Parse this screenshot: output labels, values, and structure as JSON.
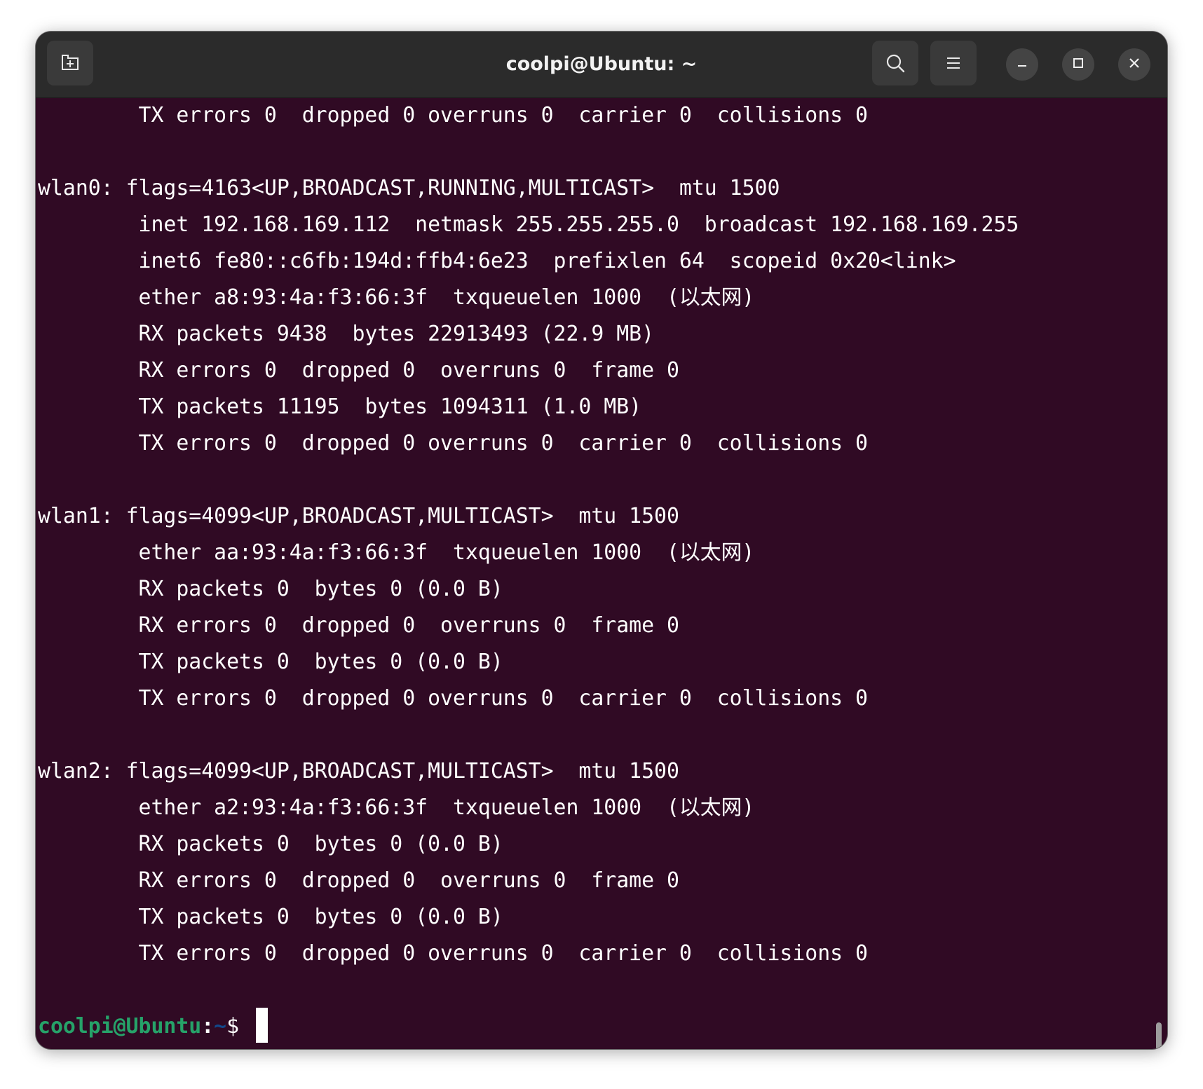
{
  "window": {
    "title": "coolpi@Ubuntu: ~"
  },
  "toolbar": {
    "new_tab_icon": "new-tab-icon",
    "search_icon": "search-icon",
    "menu_icon": "hamburger-menu-icon",
    "minimize_icon": "minimize-icon",
    "maximize_icon": "maximize-icon",
    "close_icon": "close-icon"
  },
  "colors": {
    "terminal_bg": "#300a24",
    "titlebar_bg": "#2b2b2b",
    "prompt_user": "#26a269",
    "prompt_path": "#12488b",
    "text": "#ffffff"
  },
  "terminal": {
    "lines": [
      "        TX errors 0  dropped 0 overruns 0  carrier 0  collisions 0",
      "",
      "wlan0: flags=4163<UP,BROADCAST,RUNNING,MULTICAST>  mtu 1500",
      "        inet 192.168.169.112  netmask 255.255.255.0  broadcast 192.168.169.255",
      "        inet6 fe80::c6fb:194d:ffb4:6e23  prefixlen 64  scopeid 0x20<link>",
      "        ether a8:93:4a:f3:66:3f  txqueuelen 1000  (以太网)",
      "        RX packets 9438  bytes 22913493 (22.9 MB)",
      "        RX errors 0  dropped 0  overruns 0  frame 0",
      "        TX packets 11195  bytes 1094311 (1.0 MB)",
      "        TX errors 0  dropped 0 overruns 0  carrier 0  collisions 0",
      "",
      "wlan1: flags=4099<UP,BROADCAST,MULTICAST>  mtu 1500",
      "        ether aa:93:4a:f3:66:3f  txqueuelen 1000  (以太网)",
      "        RX packets 0  bytes 0 (0.0 B)",
      "        RX errors 0  dropped 0  overruns 0  frame 0",
      "        TX packets 0  bytes 0 (0.0 B)",
      "        TX errors 0  dropped 0 overruns 0  carrier 0  collisions 0",
      "",
      "wlan2: flags=4099<UP,BROADCAST,MULTICAST>  mtu 1500",
      "        ether a2:93:4a:f3:66:3f  txqueuelen 1000  (以太网)",
      "        RX packets 0  bytes 0 (0.0 B)",
      "        RX errors 0  dropped 0  overruns 0  frame 0",
      "        TX packets 0  bytes 0 (0.0 B)",
      "        TX errors 0  dropped 0 overruns 0  carrier 0  collisions 0",
      ""
    ],
    "prompt": {
      "user_host": "coolpi@Ubuntu",
      "colon": ":",
      "path": "~",
      "symbol": "$ "
    }
  }
}
